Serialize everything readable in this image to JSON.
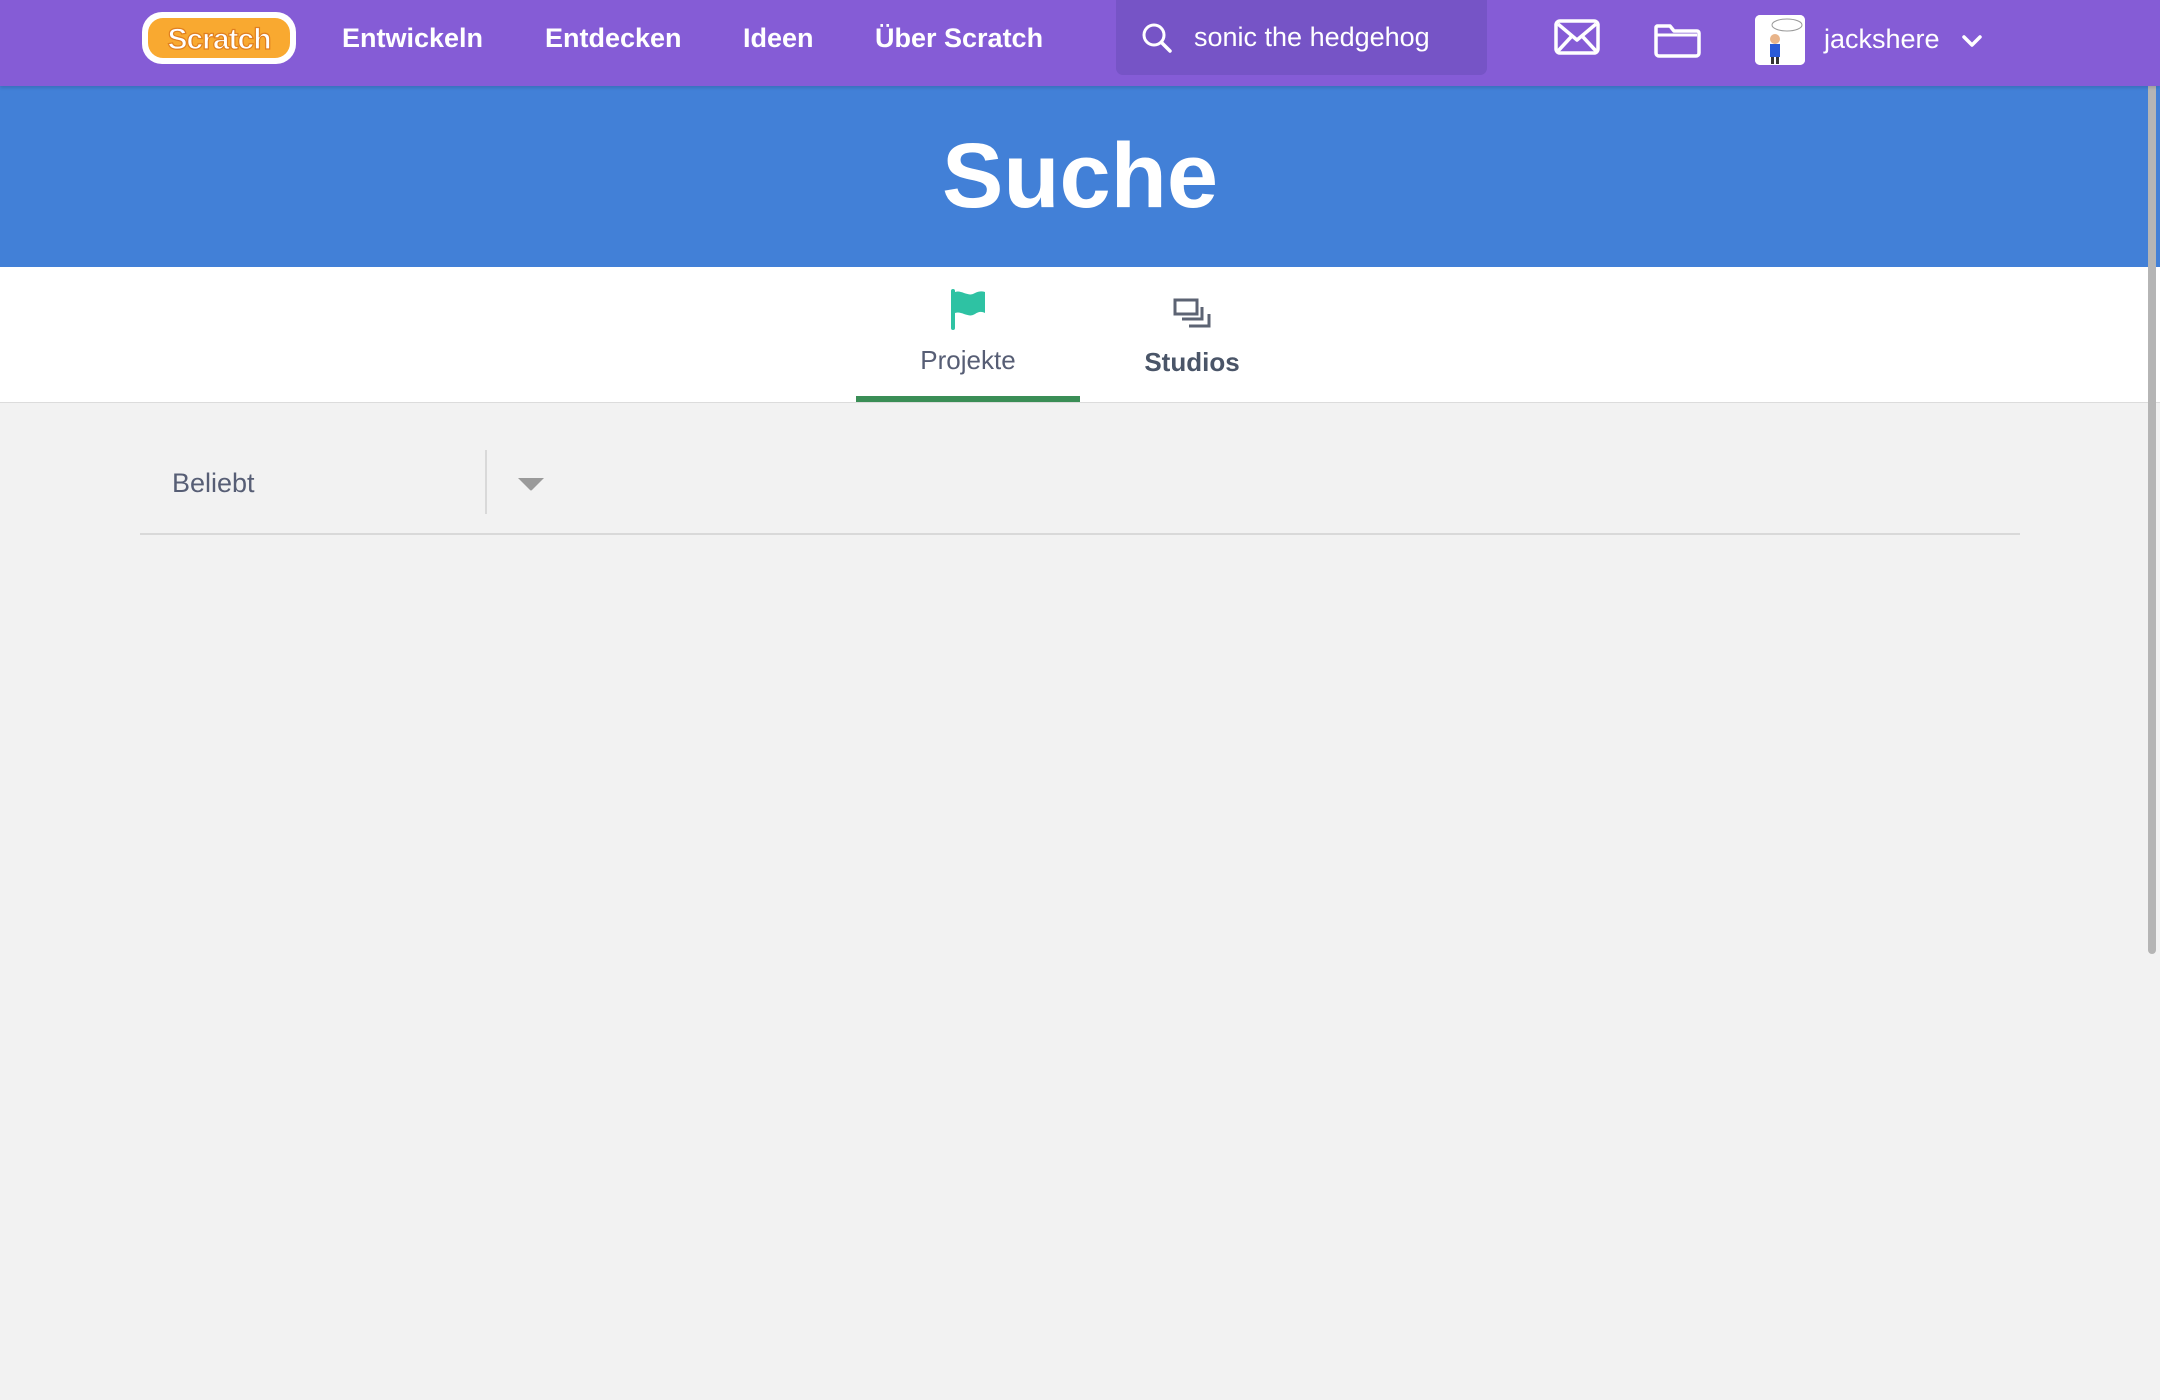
{
  "navbar": {
    "logo_text": "Scratch",
    "links": [
      {
        "label": "Entwickeln"
      },
      {
        "label": "Entdecken"
      },
      {
        "label": "Ideen"
      },
      {
        "label": "Über Scratch"
      }
    ],
    "search": {
      "value": "sonic the hedgehog",
      "icon": "search-icon"
    },
    "messages_icon": "envelope-icon",
    "mystuff_icon": "folder-icon",
    "user": {
      "username": "jackshere",
      "menu_icon": "chevron-down-icon"
    }
  },
  "banner": {
    "title": "Suche"
  },
  "tabs": [
    {
      "label": "Projekte",
      "icon": "flag-icon",
      "active": true
    },
    {
      "label": "Studios",
      "icon": "studios-icon",
      "active": false
    }
  ],
  "sort": {
    "selected": "Beliebt"
  },
  "colors": {
    "navbar": "#855cd6",
    "search_box": "#7654c6",
    "banner": "#4280d7",
    "tab_active_underline": "#3a8e56",
    "flag_icon": "#2ec2a3",
    "logo_orange": "#f9a930",
    "background": "#f2f2f2"
  }
}
